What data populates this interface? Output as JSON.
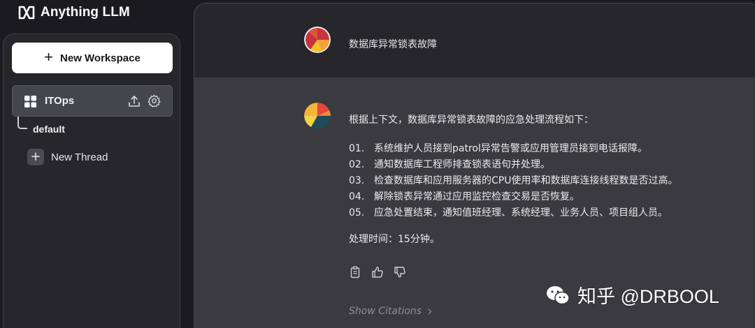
{
  "app": {
    "title": "Anything LLM",
    "logo_icon": "anything-llm-logo"
  },
  "colors": {
    "background": "#1b1b1f",
    "sidebar": "#26262b",
    "main_panel": "#3a3a3f",
    "user_row": "#27272b",
    "new_workspace_bg": "#ffffff",
    "selected_workspace": "#45454c",
    "muted_text": "#8e8e96"
  },
  "sidebar": {
    "new_workspace_label": "New Workspace",
    "workspace": {
      "name": "ITOps",
      "icon": "grid-icon",
      "actions": [
        "upload-icon",
        "gear-icon"
      ]
    },
    "threads": [
      {
        "label": "default"
      }
    ],
    "new_thread_label": "New Thread"
  },
  "chat": {
    "user_message": "数据库异常锁表故障",
    "assistant": {
      "intro": "根据上下文，数据库异常锁表故障的应急处理流程如下：",
      "steps": [
        {
          "num": "01.",
          "text": "系统维护人员接到patrol异常告警或应用管理员接到电话报障。"
        },
        {
          "num": "02.",
          "text": "通知数据库工程师排查锁表语句并处理。"
        },
        {
          "num": "03.",
          "text": "检查数据库和应用服务器的CPU使用率和数据库连接线程数是否过高。"
        },
        {
          "num": "04.",
          "text": "解除锁表异常通过应用监控检查交易是否恢复。"
        },
        {
          "num": "05.",
          "text": "应急处置结束，通知值班经理、系统经理、业务人员、项目组人员。"
        }
      ],
      "time_note": "处理时间：15分钟。",
      "actions": [
        "copy-icon",
        "thumbs-up-icon",
        "thumbs-down-icon"
      ],
      "show_citations": "Show Citations"
    }
  },
  "watermark": {
    "text": "知乎 @DRBOOL",
    "icon": "wechat-icon"
  }
}
